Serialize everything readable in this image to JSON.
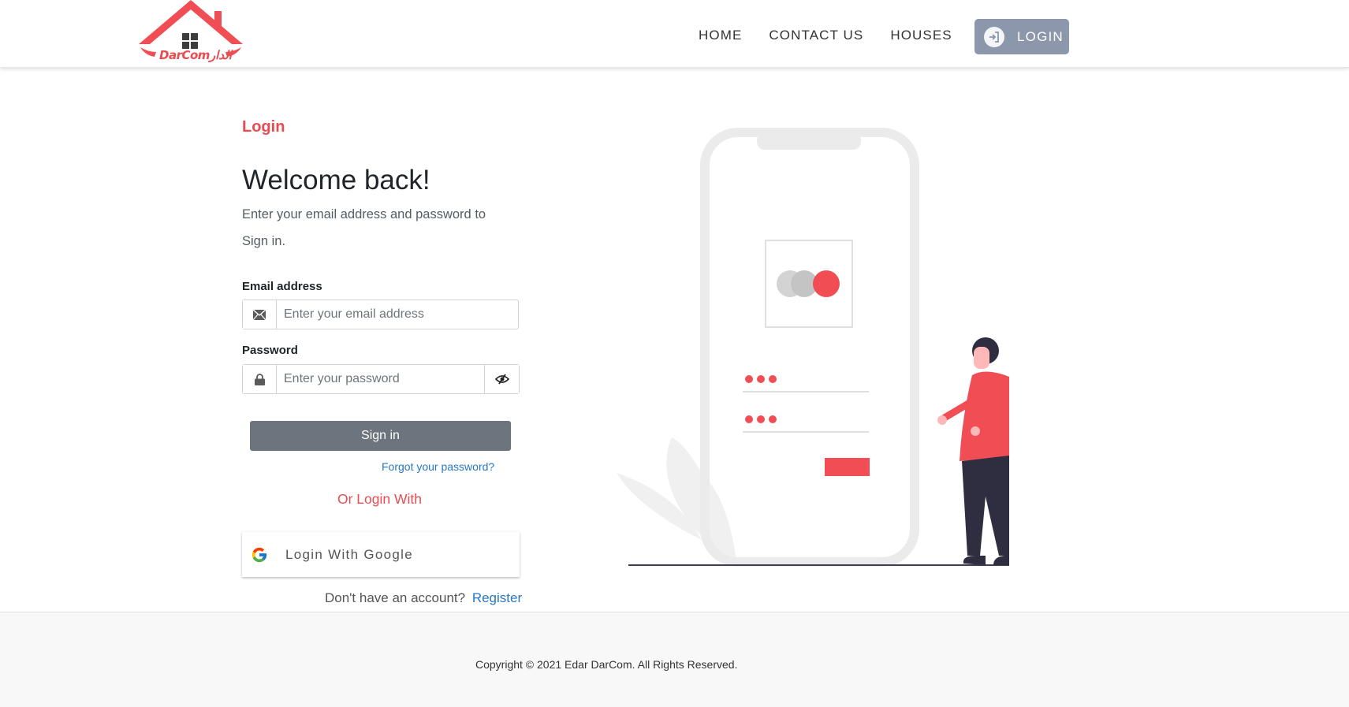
{
  "brand": {
    "logo_text": "DarComالدار",
    "accent": "#e94b50"
  },
  "nav": {
    "links": [
      "HOME",
      "CONTACT US",
      "HOUSES"
    ],
    "login_label": "LOGIN",
    "login_icon": "login-arrow-icon"
  },
  "form": {
    "section_title": "Login",
    "heading": "Welcome back!",
    "subtitle": "Enter your email address and password to Sign in.",
    "email_label": "Email address",
    "email_placeholder": "Enter your email address",
    "email_icon": "envelope-icon",
    "password_label": "Password",
    "password_placeholder": "Enter your password",
    "password_icon": "lock-icon",
    "toggle_icon": "eye-slash-icon",
    "signin_label": "Sign in",
    "forgot_label": "Forgot your password?",
    "or_login": "Or Login With",
    "google_label": "Login With Google",
    "no_account": "Don't have an account?",
    "register_label": "Register"
  },
  "footer": {
    "copyright": "Copyright © 2021 Edar DarCom. All Rights Reserved."
  },
  "colors": {
    "nav_button": "#8c97ac",
    "signin_button": "#6c757d",
    "link": "#2877c4"
  }
}
